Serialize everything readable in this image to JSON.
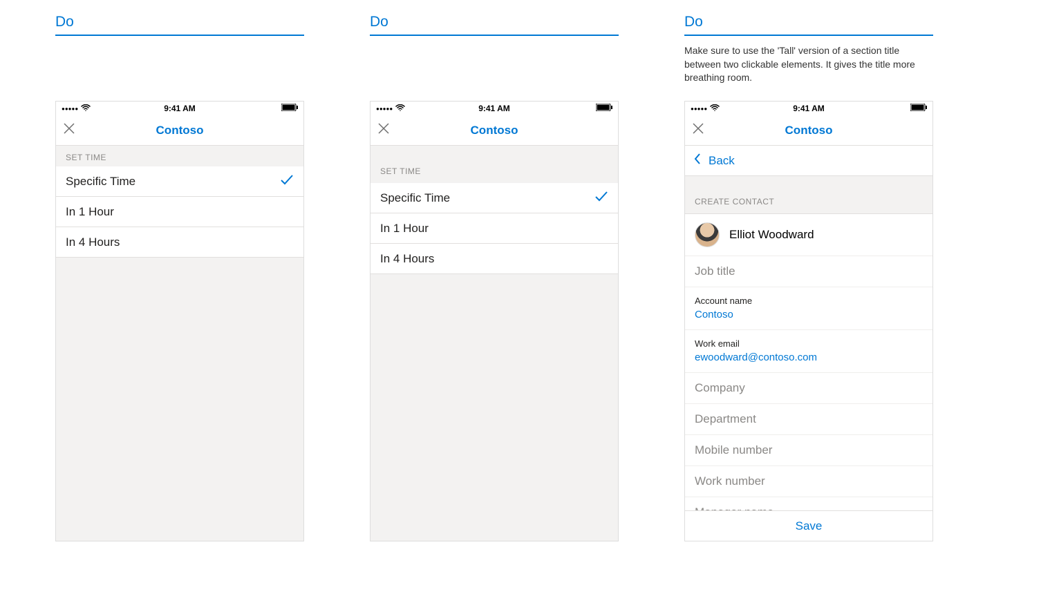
{
  "labels": {
    "do1": "Do",
    "do2": "Do",
    "do3": "Do"
  },
  "descriptions": {
    "col3": "Make sure to use the 'Tall' version of a section title between two clickable elements. It gives the title more breathing room."
  },
  "status": {
    "time": "9:41 AM"
  },
  "nav": {
    "title": "Contoso"
  },
  "back": {
    "label": "Back"
  },
  "sections": {
    "set_time": "SET TIME",
    "create_contact": "CREATE CONTACT"
  },
  "time_options": {
    "specific": "Specific Time",
    "hour1": "In 1 Hour",
    "hour4": "In 4 Hours"
  },
  "contact": {
    "name": "Elliot Woodward",
    "job_title_ph": "Job title",
    "account_label": "Account name",
    "account_value": "Contoso",
    "email_label": "Work email",
    "email_value": "ewoodward@contoso.com",
    "company_ph": "Company",
    "department_ph": "Department",
    "mobile_ph": "Mobile number",
    "work_number_ph": "Work number",
    "manager_ph": "Manager name",
    "save": "Save"
  }
}
